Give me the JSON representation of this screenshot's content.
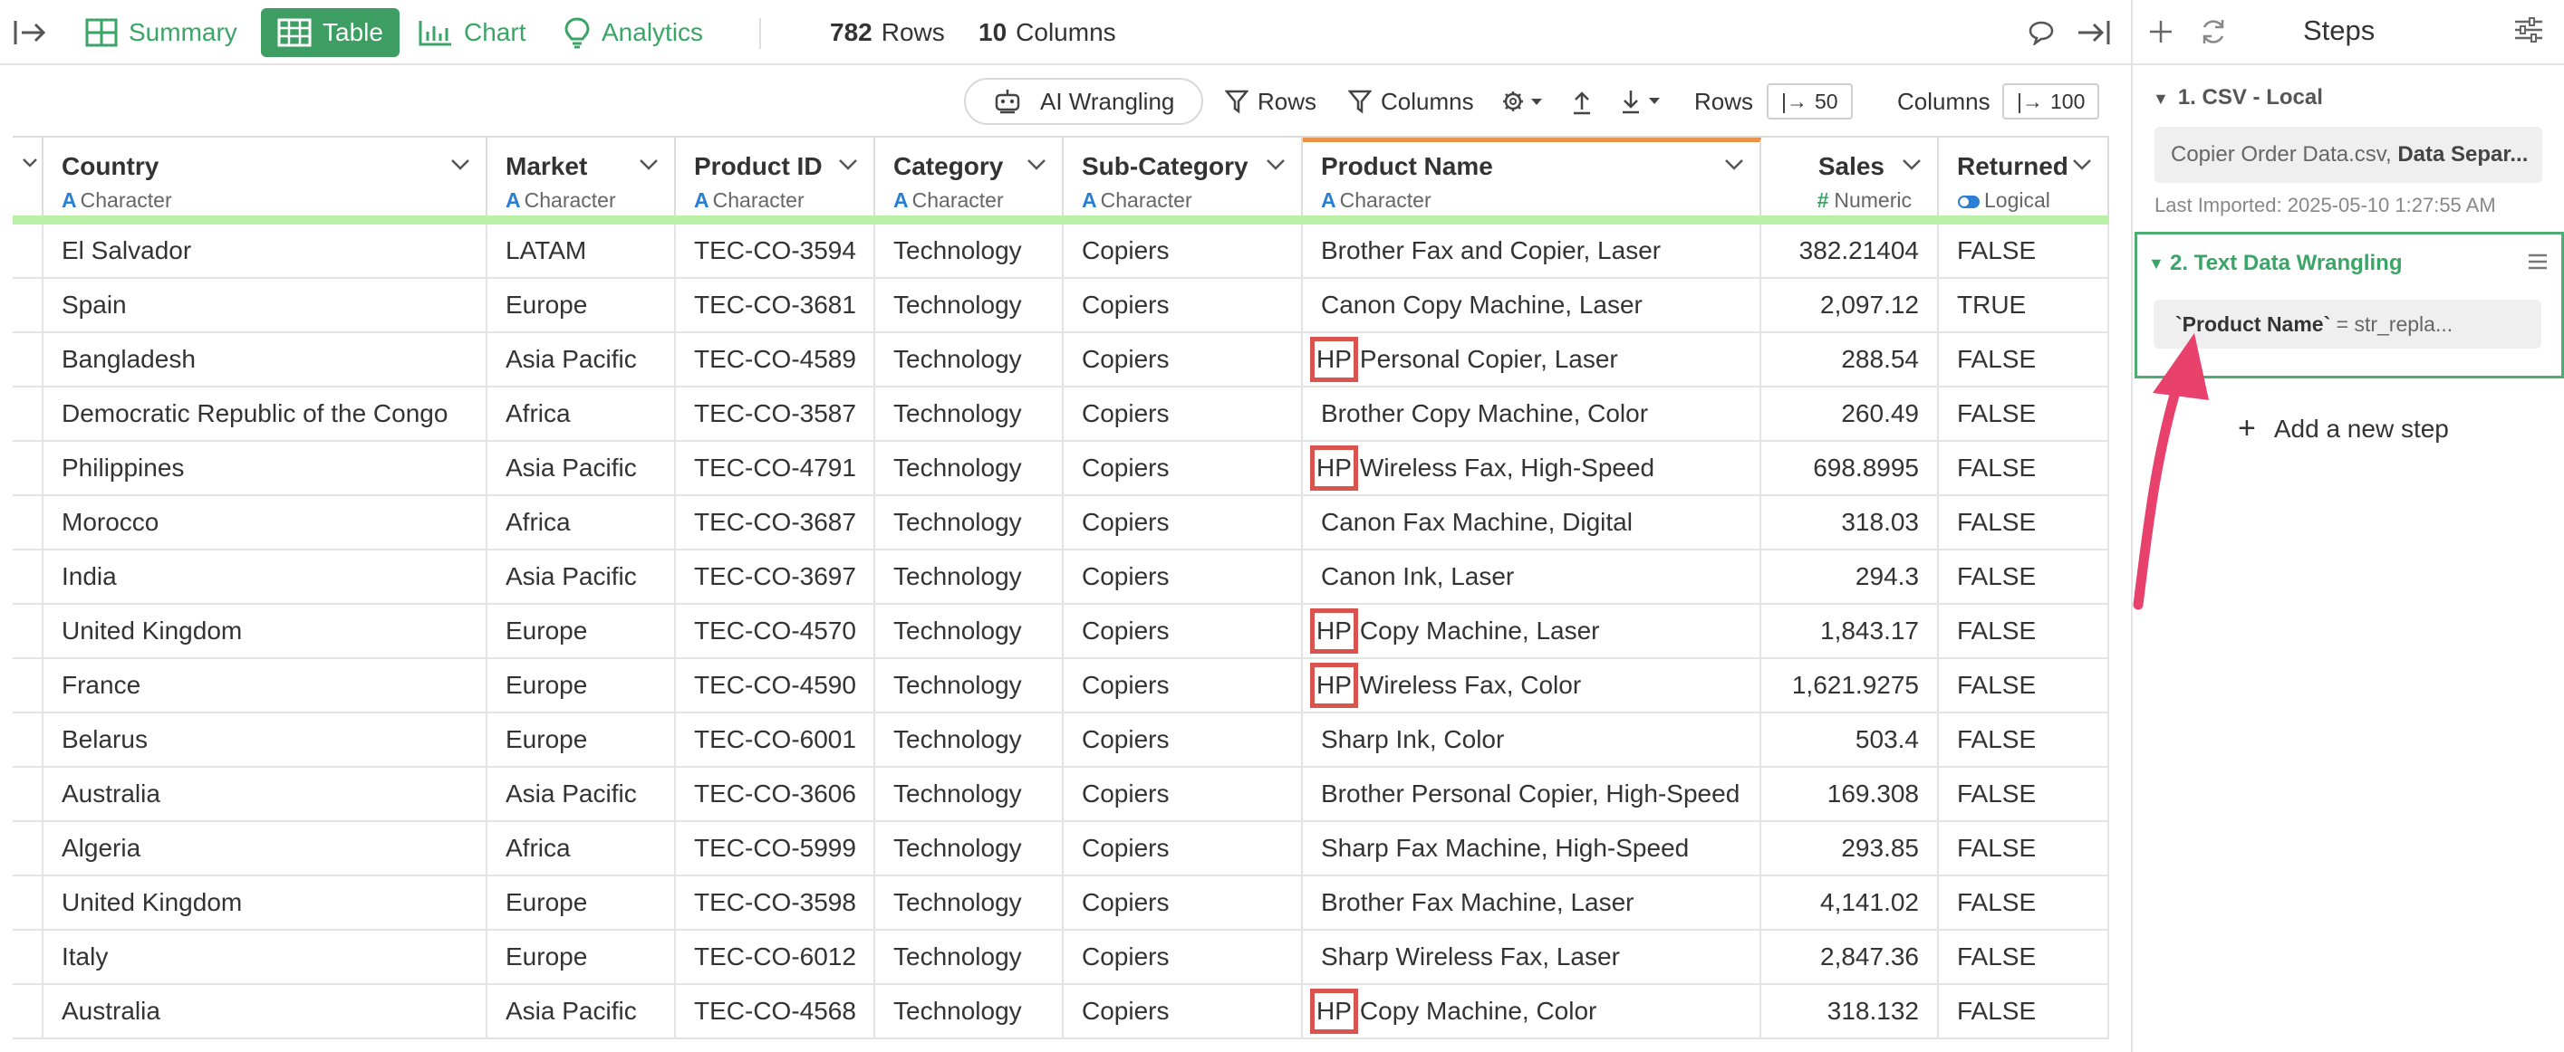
{
  "toolbar": {
    "tabs": [
      {
        "label": "Summary",
        "icon": "summary-grid-icon"
      },
      {
        "label": "Table",
        "icon": "table-grid-icon"
      },
      {
        "label": "Chart",
        "icon": "bar-chart-icon"
      },
      {
        "label": "Analytics",
        "icon": "lightbulb-icon"
      }
    ],
    "rows_count": "782",
    "rows_label": "Rows",
    "cols_count": "10",
    "cols_label": "Columns"
  },
  "toolbar2": {
    "ai_label": "AI Wrangling",
    "rows_filter": "Rows",
    "columns_filter": "Columns",
    "rows_label": "Rows",
    "rows_limit": "50",
    "columns_label": "Columns",
    "columns_limit": "100"
  },
  "table": {
    "columns": [
      {
        "name": "Country",
        "type": "Character",
        "type_icon": "A"
      },
      {
        "name": "Market",
        "type": "Character",
        "type_icon": "A"
      },
      {
        "name": "Product ID",
        "type": "Character",
        "type_icon": "A"
      },
      {
        "name": "Category",
        "type": "Character",
        "type_icon": "A"
      },
      {
        "name": "Sub-Category",
        "type": "Character",
        "type_icon": "A"
      },
      {
        "name": "Product Name",
        "type": "Character",
        "type_icon": "A"
      },
      {
        "name": "Sales",
        "type": "Numeric",
        "type_icon": "#"
      },
      {
        "name": "Returned",
        "type": "Logical",
        "type_icon": "toggle"
      }
    ],
    "rows": [
      {
        "country": "El Salvador",
        "market": "LATAM",
        "product_id": "TEC-CO-3594",
        "category": "Technology",
        "sub_category": "Copiers",
        "name_prefix": "",
        "product_name": "Brother Fax and Copier, Laser",
        "sales": "382.21404",
        "returned": "FALSE"
      },
      {
        "country": "Spain",
        "market": "Europe",
        "product_id": "TEC-CO-3681",
        "category": "Technology",
        "sub_category": "Copiers",
        "name_prefix": "",
        "product_name": "Canon Copy Machine, Laser",
        "sales": "2,097.12",
        "returned": "TRUE"
      },
      {
        "country": "Bangladesh",
        "market": "Asia Pacific",
        "product_id": "TEC-CO-4589",
        "category": "Technology",
        "sub_category": "Copiers",
        "name_prefix": "HP",
        "product_name": "Personal Copier, Laser",
        "sales": "288.54",
        "returned": "FALSE"
      },
      {
        "country": "Democratic Republic of the Congo",
        "market": "Africa",
        "product_id": "TEC-CO-3587",
        "category": "Technology",
        "sub_category": "Copiers",
        "name_prefix": "",
        "product_name": "Brother Copy Machine, Color",
        "sales": "260.49",
        "returned": "FALSE"
      },
      {
        "country": "Philippines",
        "market": "Asia Pacific",
        "product_id": "TEC-CO-4791",
        "category": "Technology",
        "sub_category": "Copiers",
        "name_prefix": "HP",
        "product_name": "Wireless Fax, High-Speed",
        "sales": "698.8995",
        "returned": "FALSE"
      },
      {
        "country": "Morocco",
        "market": "Africa",
        "product_id": "TEC-CO-3687",
        "category": "Technology",
        "sub_category": "Copiers",
        "name_prefix": "",
        "product_name": "Canon Fax Machine, Digital",
        "sales": "318.03",
        "returned": "FALSE"
      },
      {
        "country": "India",
        "market": "Asia Pacific",
        "product_id": "TEC-CO-3697",
        "category": "Technology",
        "sub_category": "Copiers",
        "name_prefix": "",
        "product_name": "Canon Ink, Laser",
        "sales": "294.3",
        "returned": "FALSE"
      },
      {
        "country": "United Kingdom",
        "market": "Europe",
        "product_id": "TEC-CO-4570",
        "category": "Technology",
        "sub_category": "Copiers",
        "name_prefix": "HP",
        "product_name": "Copy Machine, Laser",
        "sales": "1,843.17",
        "returned": "FALSE"
      },
      {
        "country": "France",
        "market": "Europe",
        "product_id": "TEC-CO-4590",
        "category": "Technology",
        "sub_category": "Copiers",
        "name_prefix": "HP",
        "product_name": "Wireless Fax, Color",
        "sales": "1,621.9275",
        "returned": "FALSE"
      },
      {
        "country": "Belarus",
        "market": "Europe",
        "product_id": "TEC-CO-6001",
        "category": "Technology",
        "sub_category": "Copiers",
        "name_prefix": "",
        "product_name": "Sharp Ink, Color",
        "sales": "503.4",
        "returned": "FALSE"
      },
      {
        "country": "Australia",
        "market": "Asia Pacific",
        "product_id": "TEC-CO-3606",
        "category": "Technology",
        "sub_category": "Copiers",
        "name_prefix": "",
        "product_name": "Brother Personal Copier, High-Speed",
        "sales": "169.308",
        "returned": "FALSE"
      },
      {
        "country": "Algeria",
        "market": "Africa",
        "product_id": "TEC-CO-5999",
        "category": "Technology",
        "sub_category": "Copiers",
        "name_prefix": "",
        "product_name": "Sharp Fax Machine, High-Speed",
        "sales": "293.85",
        "returned": "FALSE"
      },
      {
        "country": "United Kingdom",
        "market": "Europe",
        "product_id": "TEC-CO-3598",
        "category": "Technology",
        "sub_category": "Copiers",
        "name_prefix": "",
        "product_name": "Brother Fax Machine, Laser",
        "sales": "4,141.02",
        "returned": "FALSE"
      },
      {
        "country": "Italy",
        "market": "Europe",
        "product_id": "TEC-CO-6012",
        "category": "Technology",
        "sub_category": "Copiers",
        "name_prefix": "",
        "product_name": "Sharp Wireless Fax, Laser",
        "sales": "2,847.36",
        "returned": "FALSE"
      },
      {
        "country": "Australia",
        "market": "Asia Pacific",
        "product_id": "TEC-CO-4568",
        "category": "Technology",
        "sub_category": "Copiers",
        "name_prefix": "HP",
        "product_name": "Copy Machine, Color",
        "sales": "318.132",
        "returned": "FALSE"
      }
    ]
  },
  "steps": {
    "title": "Steps",
    "step1_title": "1. CSV - Local",
    "step1_file": "Copier Order Data.csv,",
    "step1_bold": "Data Separ...",
    "last_imported": "Last Imported: 2025-05-10 1:27:55 AM",
    "step2_title": "2. Text Data Wrangling",
    "step2_expr_bold": "`Product Name`",
    "step2_expr_rest": "= str_repla...",
    "add_step": "Add a new step"
  },
  "colors": {
    "accent_green": "#3e9d62",
    "highlight_red": "#d9534f",
    "arrow_pink": "#e8416b",
    "header_underline": "#b9f0a6",
    "selected_column": "#e8934a"
  }
}
